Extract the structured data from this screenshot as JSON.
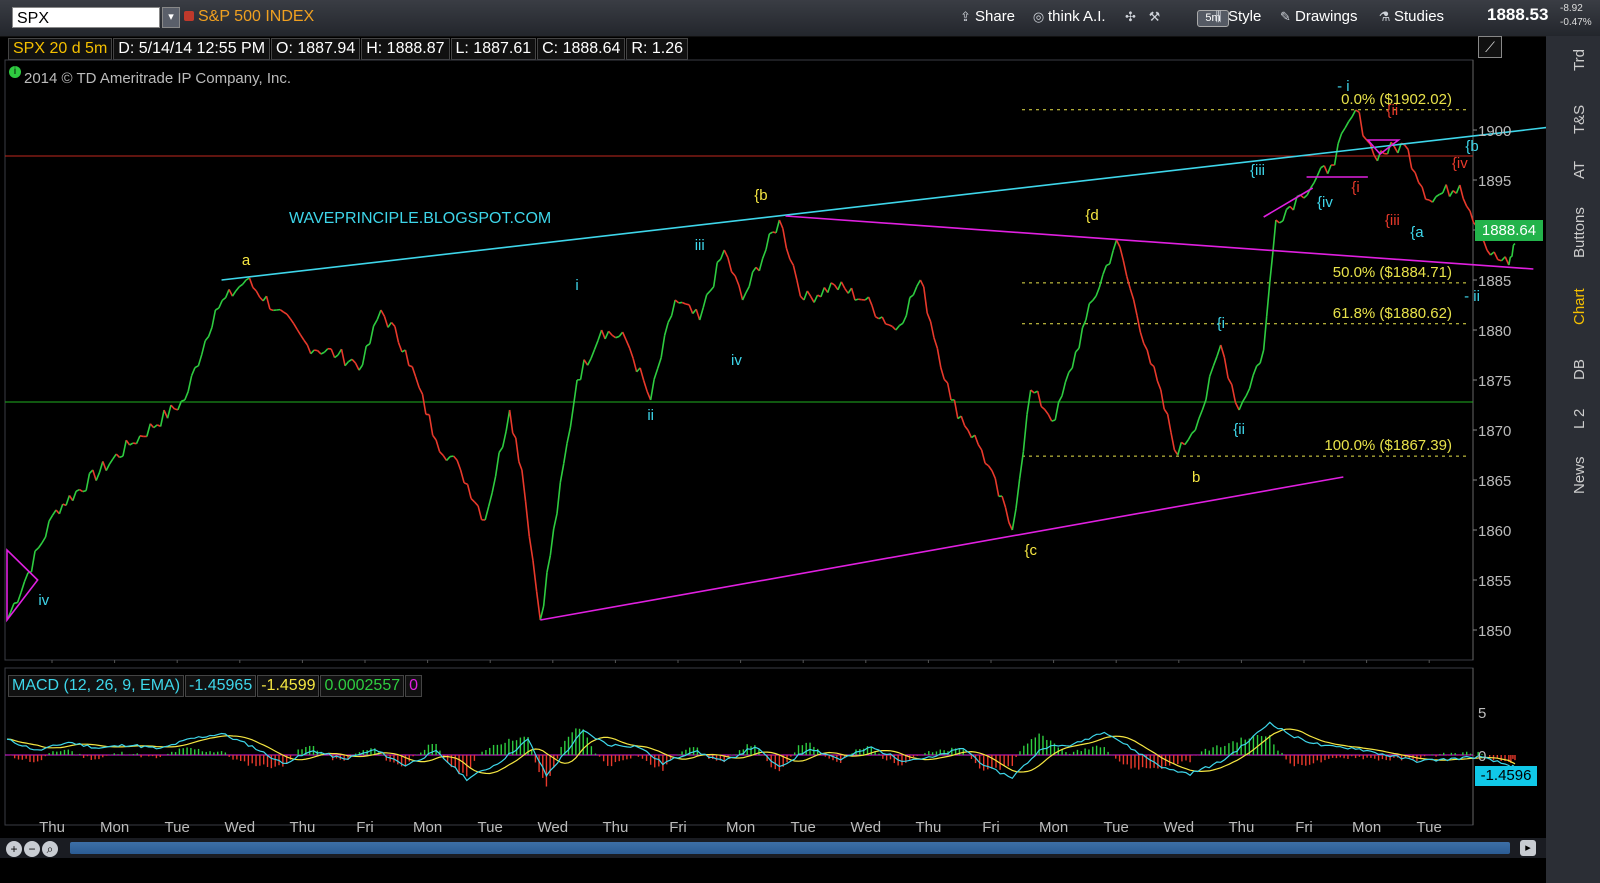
{
  "toolbar": {
    "symbol": "SPX",
    "title": "S&P 500 INDEX",
    "share": "Share",
    "think": "think A.I.",
    "timeframe": "5m",
    "style": "Style",
    "drawings": "Drawings",
    "studies": "Studies",
    "last_price": "1888.53",
    "change": "-8.92",
    "change_pct": "-0.47%"
  },
  "infobar": {
    "symbol_period": "SPX 20 d 5m",
    "date": "D: 5/14/14 12:55 PM",
    "open": "O: 1887.94",
    "high": "H: 1888.87",
    "low": "L: 1887.61",
    "close": "C: 1888.64",
    "range": "R: 1.26"
  },
  "copyright": "2014 © TD Ameritrade IP Company, Inc.",
  "right_tabs": [
    "Trd",
    "T&S",
    "AT",
    "Buttons",
    "Chart",
    "DB",
    "L 2",
    "News"
  ],
  "colors": {
    "up": "#2ecc40",
    "down": "#e8392b",
    "cyan": "#3ed6ea",
    "magenta": "#e020e0",
    "yellow": "#f5e642",
    "fib": "#e8e24a",
    "resistance_red": "#c0281e",
    "support_green": "#20b020"
  },
  "chart_data": [
    {
      "type": "line",
      "title": "S&P 500 INDEX",
      "subtitle": "SPX 20 d 5m",
      "last_value": "1888.64",
      "ylim": [
        1847,
        1907
      ],
      "y_ticks": [
        "1900",
        "1895",
        "1890",
        "1885",
        "1880",
        "1875",
        "1870",
        "1865",
        "1860",
        "1855",
        "1850"
      ],
      "x_ticks": [
        "Thu",
        "Mon",
        "Tue",
        "Wed",
        "Thu",
        "Fri",
        "Mon",
        "Tue",
        "Wed",
        "Thu",
        "Fri",
        "Mon",
        "Tue",
        "Wed",
        "Thu",
        "Fri",
        "Mon",
        "Tue",
        "Wed",
        "Thu",
        "Fri",
        "Mon",
        "Tue"
      ],
      "price_path": [
        [
          0.0,
          1851
        ],
        [
          0.8,
          1862
        ],
        [
          2.0,
          1868.5
        ],
        [
          2.9,
          1873
        ],
        [
          3.4,
          1882
        ],
        [
          3.9,
          1885
        ],
        [
          4.4,
          1882
        ],
        [
          4.9,
          1878.5
        ],
        [
          5.4,
          1877.5
        ],
        [
          5.8,
          1876.5
        ],
        [
          6.1,
          1882
        ],
        [
          6.5,
          1878
        ],
        [
          7.0,
          1869
        ],
        [
          7.4,
          1866
        ],
        [
          7.8,
          1861
        ],
        [
          8.2,
          1872
        ],
        [
          8.4,
          1866
        ],
        [
          8.7,
          1851
        ],
        [
          9.3,
          1875
        ],
        [
          9.7,
          1880
        ],
        [
          10.1,
          1879
        ],
        [
          10.5,
          1873
        ],
        [
          10.9,
          1883
        ],
        [
          11.3,
          1881
        ],
        [
          11.7,
          1888
        ],
        [
          12.0,
          1883
        ],
        [
          12.6,
          1891
        ],
        [
          13.0,
          1883
        ],
        [
          13.5,
          1884.5
        ],
        [
          14.0,
          1883
        ],
        [
          14.5,
          1880
        ],
        [
          14.9,
          1885
        ],
        [
          15.4,
          1873
        ],
        [
          15.9,
          1868
        ],
        [
          16.4,
          1860
        ],
        [
          16.7,
          1874
        ],
        [
          17.1,
          1871
        ],
        [
          17.6,
          1881
        ],
        [
          18.1,
          1889
        ],
        [
          18.6,
          1878
        ],
        [
          19.1,
          1867.5
        ],
        [
          19.5,
          1872
        ],
        [
          19.8,
          1878.5
        ],
        [
          20.1,
          1872
        ],
        [
          20.5,
          1878
        ],
        [
          20.7,
          1891
        ],
        [
          21.1,
          1893.5
        ],
        [
          21.6,
          1896.5
        ],
        [
          22.0,
          1902
        ],
        [
          22.3,
          1897.5
        ],
        [
          22.8,
          1898.5
        ],
        [
          23.2,
          1893
        ],
        [
          23.7,
          1894.5
        ],
        [
          24.2,
          1887.5
        ],
        [
          24.5,
          1886.5
        ],
        [
          24.6,
          1888.64
        ]
      ],
      "fib_levels": [
        {
          "pct": "0.0%",
          "value": 1902.02,
          "label": "0.0%  ($1902.02)"
        },
        {
          "pct": "50.0%",
          "value": 1884.71,
          "label": "50.0%  ($1884.71)"
        },
        {
          "pct": "61.8%",
          "value": 1880.62,
          "label": "61.8%  ($1880.62)"
        },
        {
          "pct": "100.0%",
          "value": 1867.39,
          "label": "100.0%  ($1867.39)"
        }
      ],
      "horizontal_lines": [
        {
          "value": 1897.4,
          "color": "resistance"
        },
        {
          "value": 1872.8,
          "color": "support"
        }
      ],
      "trend_lines": [
        {
          "name": "cyan-upper",
          "from": [
            3.5,
            1885
          ],
          "to": [
            27.6,
            1902
          ]
        },
        {
          "name": "magenta-upper",
          "from": [
            12.7,
            1891.4
          ],
          "to": [
            24.9,
            1886.1
          ]
        },
        {
          "name": "magenta-lower",
          "from": [
            8.7,
            1851
          ],
          "to": [
            21.8,
            1865.3
          ]
        }
      ],
      "annotations": [
        {
          "text": "WAVEPRINCIPLE.BLOGSPOT.COM",
          "x": 4.6,
          "y": 1890.7,
          "color": "cyan"
        },
        {
          "text": "a",
          "x": 3.9,
          "y": 1886.5,
          "color": "yellow"
        },
        {
          "text": "{b",
          "x": 12.3,
          "y": 1893.0,
          "color": "yellow"
        },
        {
          "text": "{d",
          "x": 17.7,
          "y": 1891.0,
          "color": "yellow"
        },
        {
          "text": "{c",
          "x": 16.7,
          "y": 1857.5,
          "color": "yellow"
        },
        {
          "text": "b",
          "x": 19.4,
          "y": 1864.8,
          "color": "yellow"
        },
        {
          "text": "iv",
          "x": 0.6,
          "y": 1852.5,
          "color": "cyan"
        },
        {
          "text": "i",
          "x": 9.3,
          "y": 1884.0,
          "color": "cyan"
        },
        {
          "text": "ii",
          "x": 10.5,
          "y": 1871.0,
          "color": "cyan"
        },
        {
          "text": "iii",
          "x": 11.3,
          "y": 1888.0,
          "color": "cyan"
        },
        {
          "text": "iv",
          "x": 11.9,
          "y": 1876.5,
          "color": "cyan"
        },
        {
          "text": "{i",
          "x": 19.8,
          "y": 1880.2,
          "color": "cyan"
        },
        {
          "text": "{ii",
          "x": 20.1,
          "y": 1869.6,
          "color": "cyan"
        },
        {
          "text": "{iii",
          "x": 20.4,
          "y": 1895.5,
          "color": "cyan"
        },
        {
          "text": "{iv",
          "x": 21.5,
          "y": 1892.3,
          "color": "cyan"
        },
        {
          "text": "- i",
          "x": 21.8,
          "y": 1903.9,
          "color": "cyan"
        },
        {
          "text": "{ii",
          "x": 22.6,
          "y": 1901.5,
          "color": "red"
        },
        {
          "text": "{i",
          "x": 22.0,
          "y": 1893.8,
          "color": "red"
        },
        {
          "text": "{iii",
          "x": 22.6,
          "y": 1890.5,
          "color": "red"
        },
        {
          "text": "{a",
          "x": 23.0,
          "y": 1889.3,
          "color": "cyan"
        },
        {
          "text": "{iv",
          "x": 23.7,
          "y": 1896.2,
          "color": "red"
        },
        {
          "text": "{b",
          "x": 23.9,
          "y": 1897.9,
          "color": "cyan"
        },
        {
          "text": "- ii",
          "x": 23.9,
          "y": 1882.9,
          "color": "cyan"
        }
      ],
      "triangles": [
        {
          "points": [
            [
              0.0,
              1858
            ],
            [
              0.0,
              1851
            ],
            [
              0.5,
              1855
            ]
          ],
          "color": "magenta"
        },
        {
          "points": [
            [
              21.2,
              1895.3
            ],
            [
              22.2,
              1895.3
            ]
          ],
          "color": "magenta"
        },
        {
          "points": [
            [
              20.5,
              1891.3
            ],
            [
              21.3,
              1894.2
            ]
          ],
          "color": "magenta"
        },
        {
          "points": [
            [
              22.2,
              1899.0
            ],
            [
              22.7,
              1899.0
            ],
            [
              22.4,
              1897.6
            ]
          ],
          "color": "magenta"
        }
      ]
    },
    {
      "type": "line",
      "title": "MACD (12, 26, 9, EMA)",
      "values_header": [
        "-1.45965",
        "-1.4599",
        "0.0002557",
        "0"
      ],
      "last_value": "-1.4596",
      "ylim": [
        -7,
        7
      ],
      "y_ticks": [
        "5",
        "0"
      ],
      "series": [
        {
          "name": "-1.45965"
        },
        {
          "name": "-1.4599"
        },
        {
          "name": "0.0002557"
        }
      ],
      "macd_path": [
        [
          0.0,
          1.8
        ],
        [
          0.5,
          0.5
        ],
        [
          1.0,
          1.5
        ],
        [
          1.5,
          0.8
        ],
        [
          2.0,
          1.2
        ],
        [
          2.5,
          0.7
        ],
        [
          3.0,
          1.9
        ],
        [
          3.5,
          2.5
        ],
        [
          4.0,
          1.0
        ],
        [
          4.5,
          -1.0
        ],
        [
          5.0,
          0.5
        ],
        [
          5.5,
          -0.5
        ],
        [
          6.0,
          0.6
        ],
        [
          6.5,
          -1.2
        ],
        [
          7.0,
          0.4
        ],
        [
          7.5,
          -2.8
        ],
        [
          8.0,
          -1.0
        ],
        [
          8.5,
          1.8
        ],
        [
          8.8,
          -2.4
        ],
        [
          9.4,
          2.8
        ],
        [
          9.8,
          1.2
        ],
        [
          10.3,
          1.0
        ],
        [
          10.7,
          -1.0
        ],
        [
          11.2,
          0.5
        ],
        [
          11.7,
          -0.8
        ],
        [
          12.2,
          1.0
        ],
        [
          12.6,
          -1.5
        ],
        [
          13.1,
          0.8
        ],
        [
          13.6,
          -0.5
        ],
        [
          14.1,
          0.9
        ],
        [
          14.6,
          -0.6
        ],
        [
          15.1,
          -0.3
        ],
        [
          15.6,
          0.8
        ],
        [
          16.0,
          -1.5
        ],
        [
          16.4,
          -2.6
        ],
        [
          16.9,
          0.9
        ],
        [
          17.4,
          1.2
        ],
        [
          17.9,
          2.8
        ],
        [
          18.4,
          0.5
        ],
        [
          18.9,
          -1.6
        ],
        [
          19.3,
          -2.2
        ],
        [
          19.8,
          -0.8
        ],
        [
          20.2,
          1.3
        ],
        [
          20.6,
          3.8
        ],
        [
          21.0,
          2.1
        ],
        [
          21.5,
          1.0
        ],
        [
          22.0,
          0.8
        ],
        [
          22.5,
          0.0
        ],
        [
          23.0,
          -0.7
        ],
        [
          23.5,
          -0.5
        ],
        [
          24.0,
          -0.2
        ],
        [
          24.5,
          -1.2
        ],
        [
          24.6,
          -1.46
        ]
      ]
    }
  ]
}
